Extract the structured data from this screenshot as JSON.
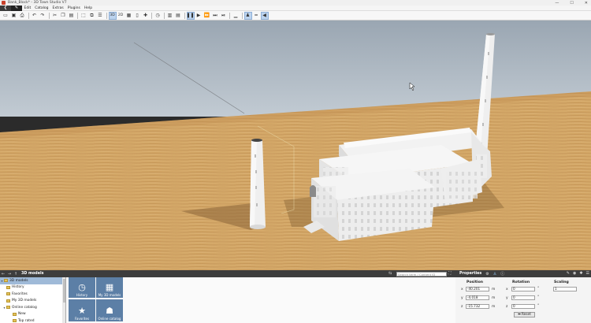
{
  "window": {
    "title": "Bank_Block* - 3D Town Studio V7",
    "controls": [
      "—",
      "☐",
      "✕"
    ]
  },
  "menu": {
    "items": [
      "Edit",
      "Catalog",
      "Extras",
      "Plugins",
      "Help"
    ]
  },
  "toolbar": {
    "view_3d": "3D",
    "view_2d": "2D"
  },
  "catalog": {
    "title": "3D models",
    "search_placeholder": "Search term / Content ID",
    "tree": [
      {
        "label": "3D models",
        "level": 0,
        "expanded": true,
        "selected": true
      },
      {
        "label": "History",
        "level": 1
      },
      {
        "label": "Favorites",
        "level": 1
      },
      {
        "label": "My 3D models",
        "level": 1
      },
      {
        "label": "Online catalog",
        "level": 1,
        "expanded": true
      },
      {
        "label": "New",
        "level": 2
      },
      {
        "label": "Top rated",
        "level": 2
      }
    ],
    "tiles": [
      {
        "label": "History",
        "icon": "clock-icon"
      },
      {
        "label": "My 3D models",
        "icon": "grid-icon"
      },
      {
        "label": "Favorites",
        "icon": "star-icon"
      },
      {
        "label": "Online catalog",
        "icon": "people-icon"
      }
    ],
    "colors": {
      "tile": "#5c7fa6"
    }
  },
  "properties": {
    "title": "Properties",
    "position_label": "Position",
    "rotation_label": "Rotation",
    "scaling_label": "Scaling",
    "position": {
      "x": "-40.201",
      "y": "-4.018",
      "z": "-15.732"
    },
    "rotation": {
      "x": "0",
      "y": "0",
      "z": "0"
    },
    "scaling": "1",
    "length_unit": "m",
    "angle_unit": "°",
    "reset_label": "Reset"
  }
}
